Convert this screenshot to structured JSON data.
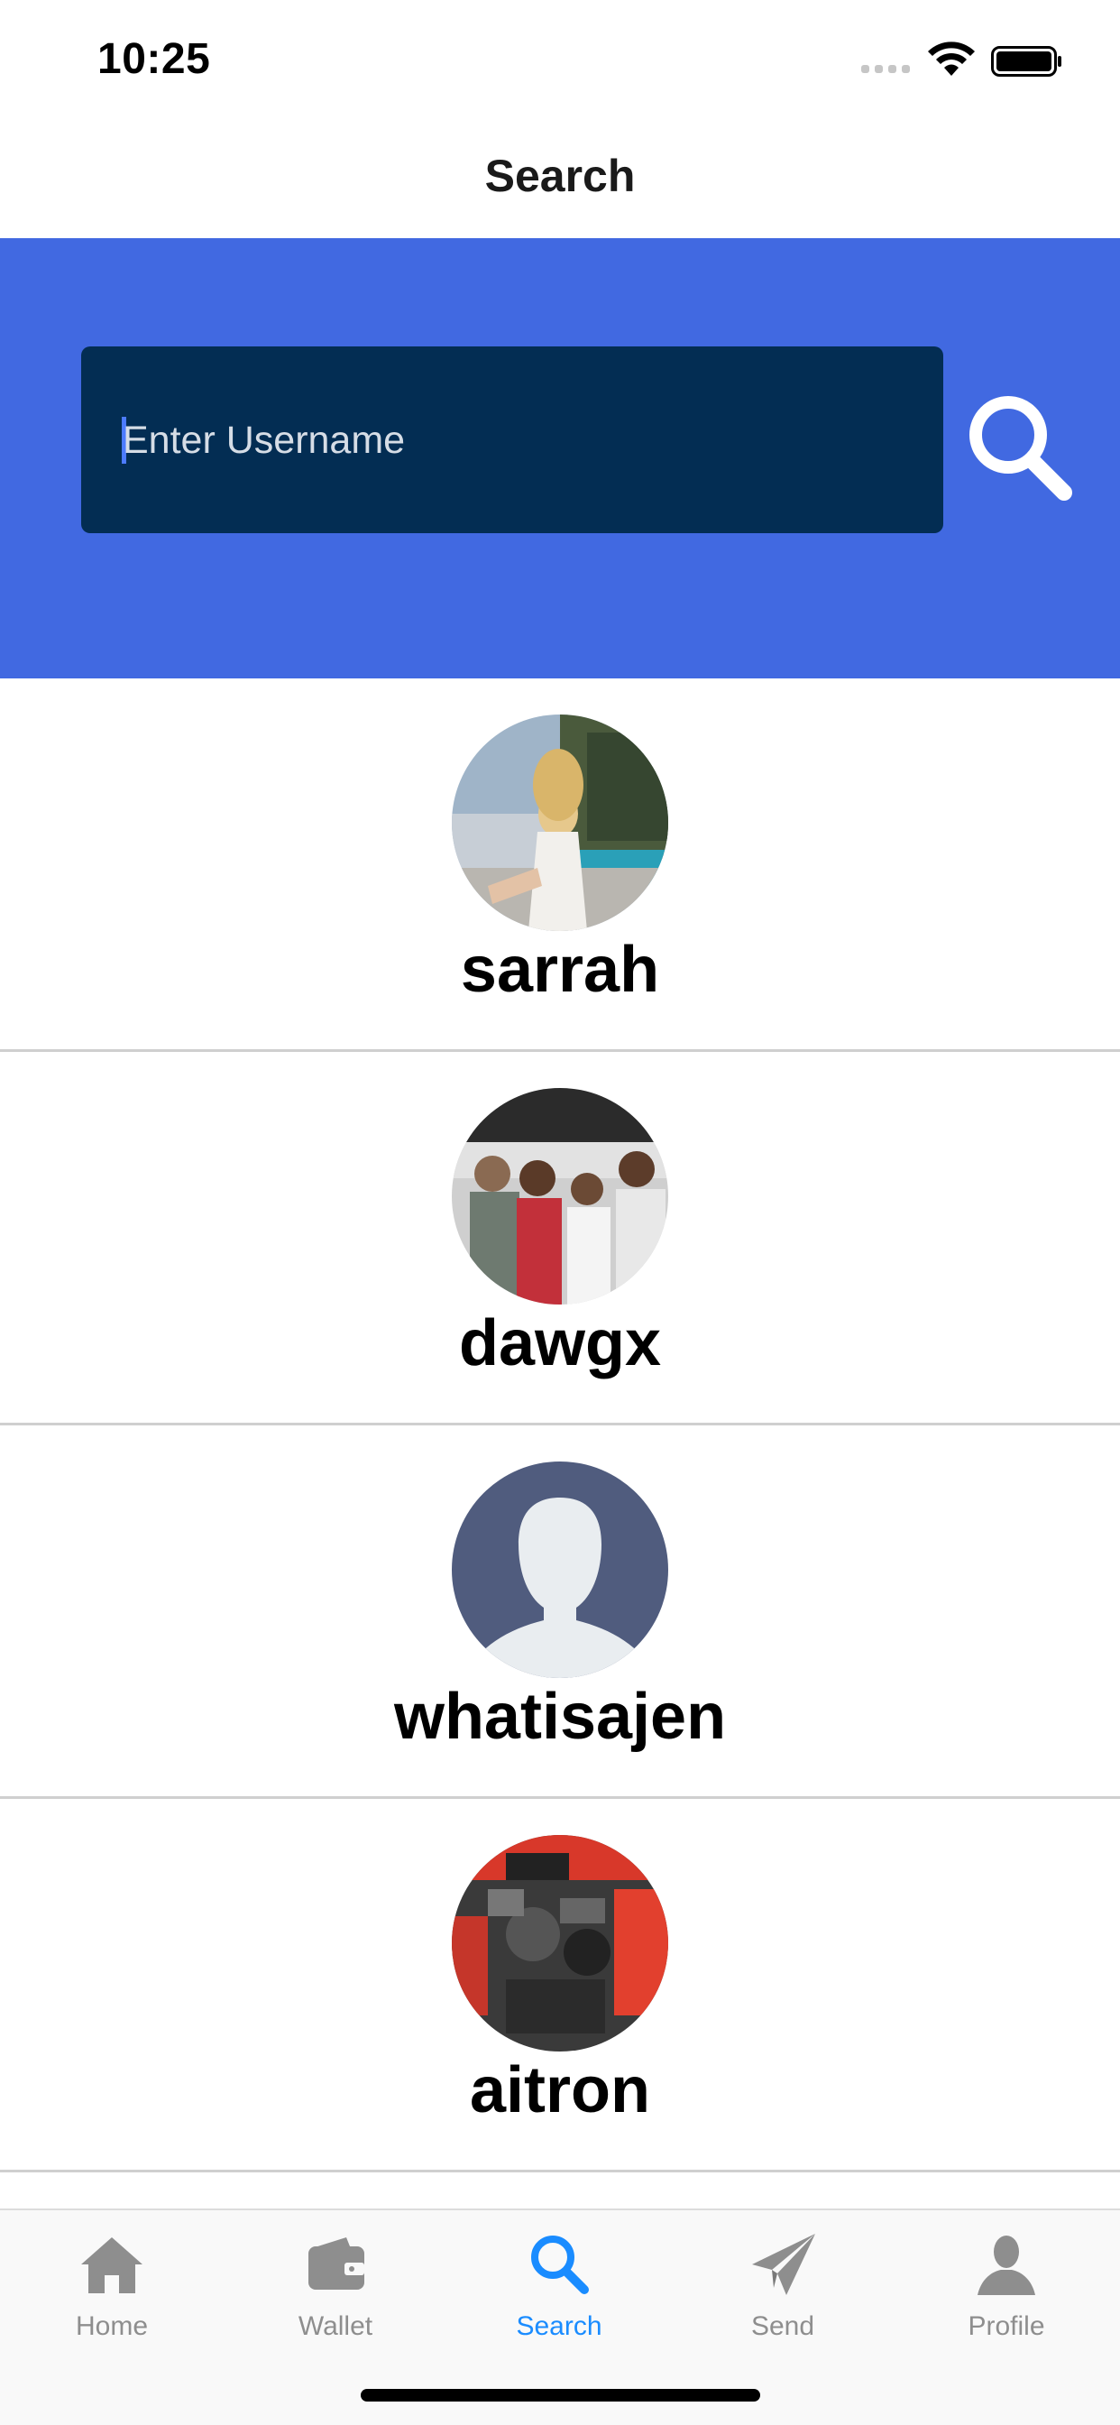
{
  "status_bar": {
    "time": "10:25"
  },
  "nav": {
    "title": "Search"
  },
  "search": {
    "placeholder": "Enter Username",
    "value": ""
  },
  "users": [
    {
      "username": "sarrah",
      "avatar": "photo"
    },
    {
      "username": "dawgx",
      "avatar": "photo"
    },
    {
      "username": "whatisajen",
      "avatar": "default-person-icon"
    },
    {
      "username": "aitron",
      "avatar": "photo"
    }
  ],
  "tabs": [
    {
      "label": "Home",
      "icon": "home-icon",
      "active": false
    },
    {
      "label": "Wallet",
      "icon": "wallet-icon",
      "active": false
    },
    {
      "label": "Search",
      "icon": "search-icon",
      "active": true
    },
    {
      "label": "Send",
      "icon": "paper-plane-icon",
      "active": false
    },
    {
      "label": "Profile",
      "icon": "person-icon",
      "active": false
    }
  ],
  "colors": {
    "header_blue": "#4169E1",
    "search_field": "#032D53",
    "tab_active": "#1a8cff",
    "tab_inactive": "#8e8e8e"
  }
}
